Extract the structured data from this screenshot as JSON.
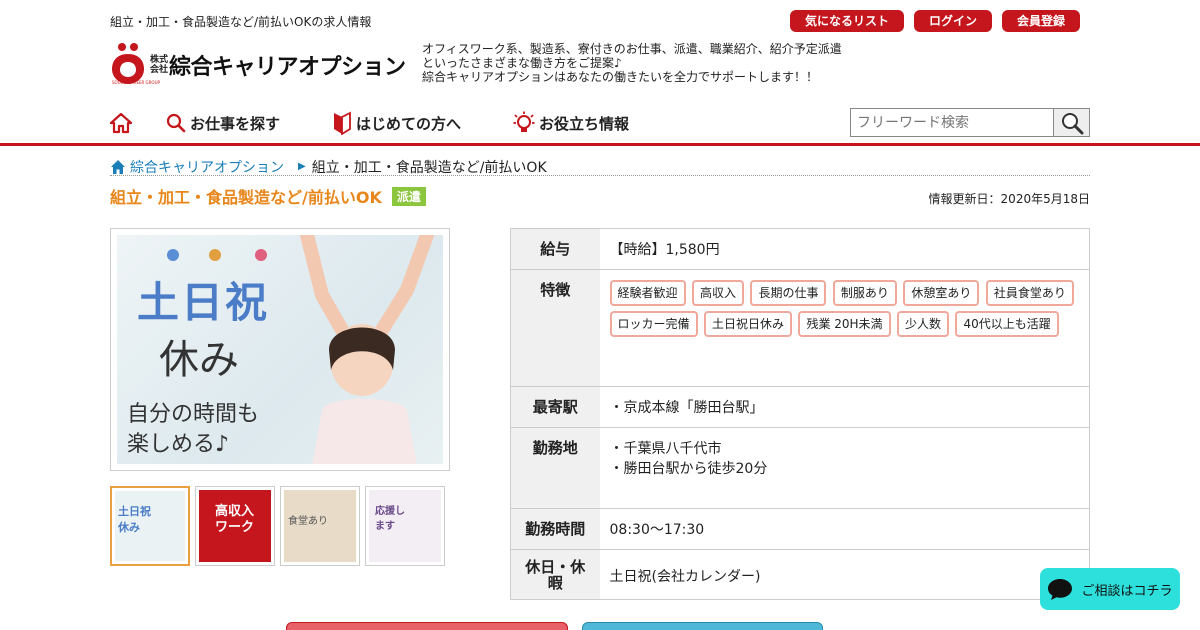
{
  "header": {
    "tagline": "組立・加工・食品製造など/前払いOKの求人情報",
    "buttons": [
      "気になるリスト",
      "ログイン",
      "会員登録"
    ],
    "logo_kabushiki": "株式会社",
    "logo_name": "綜合キャリアオプション",
    "logo_sub": "SOUGO CAREER GROUP",
    "description": [
      "オフィスワーク系、製造系、寮付きのお仕事、派遣、職業紹介、紹介予定派遣",
      "といったさまざまな働き方をご提案♪",
      "綜合キャリアオプションはあなたの働きたいを全力でサポートします！！"
    ]
  },
  "nav": {
    "items": [
      {
        "label": "お仕事を探す",
        "icon": "search-icon"
      },
      {
        "label": "はじめての方へ",
        "icon": "beginner-mark-icon"
      },
      {
        "label": "お役立ち情報",
        "icon": "lightbulb-icon"
      }
    ],
    "search_placeholder": "フリーワード検索"
  },
  "breadcrumb": {
    "home": "綜合キャリアオプション",
    "current": "組立・加工・食品製造など/前払いOK"
  },
  "title": "組立・加工・食品製造など/前払いOK",
  "badge": "派遣",
  "updated": "情報更新日：2020年5月18日",
  "image": {
    "line1": "土日祝",
    "line2": "休み",
    "line3": "自分の時間も",
    "line4": "楽しめる♪"
  },
  "thumbs": [
    {
      "text": "土日祝 休み"
    },
    {
      "text": "高収入ワーク"
    },
    {
      "text": "食堂あり"
    },
    {
      "text": "応援します"
    }
  ],
  "details": {
    "salary_label": "給与",
    "salary": "【時給】1,580円",
    "features_label": "特徴",
    "features": [
      "経験者歓迎",
      "高収入",
      "長期の仕事",
      "制服あり",
      "休憩室あり",
      "社員食堂あり",
      "ロッカー完備",
      "土日祝日休み",
      "残業 20H未満",
      "少人数",
      "40代以上も活躍"
    ],
    "station_label": "最寄駅",
    "station": "・京成本線「勝田台駅」",
    "location_label": "勤務地",
    "location_1": "・千葉県八千代市",
    "location_2": "・勝田台駅から徒歩20分",
    "hours_label": "勤務時間",
    "hours": "08:30～17:30",
    "holiday_label": "休日・休暇",
    "holiday": "土日祝(会社カレンダー)"
  },
  "chat": "ご相談はコチラ",
  "colors": {
    "brand_red": "#c4161c",
    "title_orange": "#e8861a",
    "badge_green": "#8cc63f",
    "chat_cyan": "#2ee0dc"
  }
}
